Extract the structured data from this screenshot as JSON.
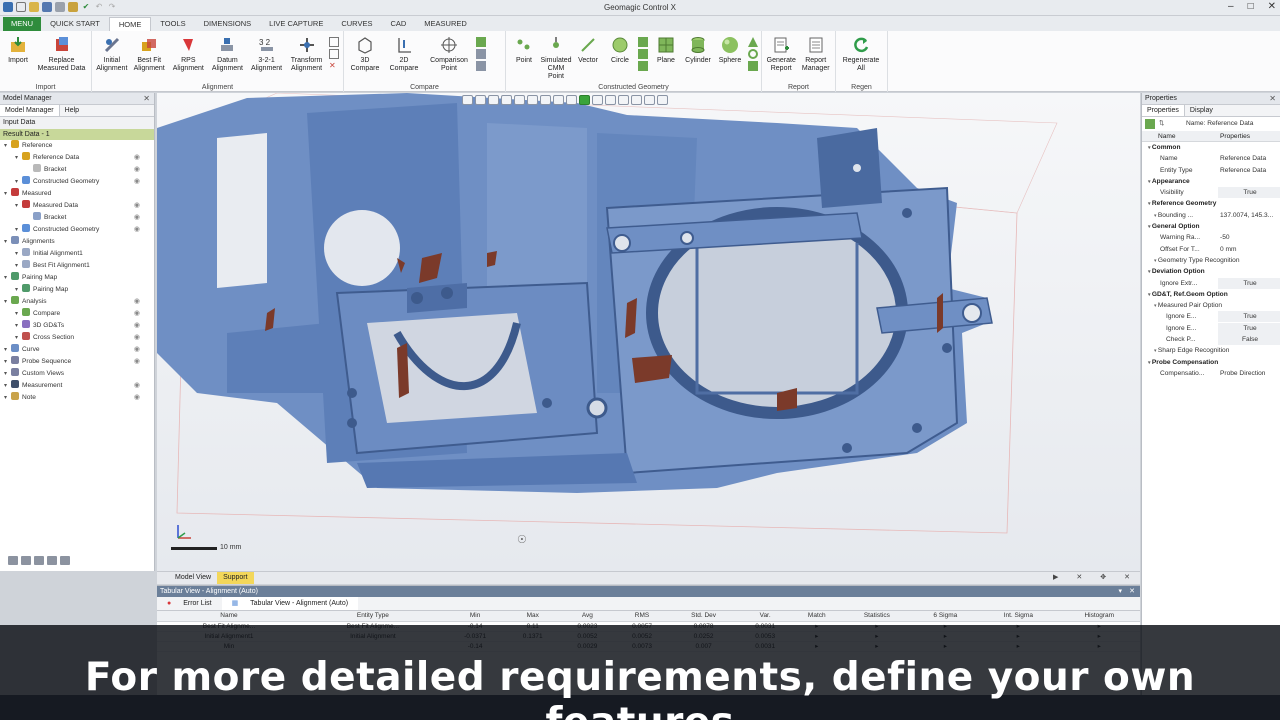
{
  "app": {
    "title": "Geomagic Control X"
  },
  "tabs": [
    "MENU",
    "QUICK START",
    "HOME",
    "TOOLS",
    "DIMENSIONS",
    "LIVE CAPTURE",
    "CURVES",
    "CAD",
    "MEASURED"
  ],
  "ribbon": {
    "groups": [
      {
        "label": "Import",
        "buttons": [
          "Import",
          "Replace Measured Data"
        ]
      },
      {
        "label": "Alignment",
        "buttons": [
          "Initial Alignment",
          "Best Fit Alignment",
          "RPS Alignment",
          "Datum Alignment",
          "3-2-1 Alignment",
          "Transform Alignment"
        ]
      },
      {
        "label": "Compare",
        "buttons": [
          "3D Compare",
          "2D Compare",
          "Comparison Point"
        ]
      },
      {
        "label": "Constructed Geometry",
        "buttons": [
          "Point",
          "Simulated CMM Point",
          "Vector",
          "Circle",
          "Plane",
          "Cylinder",
          "Sphere"
        ]
      },
      {
        "label": "Report",
        "buttons": [
          "Generate Report",
          "Report Manager"
        ]
      },
      {
        "label": "Regen",
        "buttons": [
          "Regenerate All"
        ]
      }
    ]
  },
  "left_panel": {
    "title": "Model Manager",
    "tabs": [
      "Model Manager",
      "Help"
    ],
    "section": "Input Data",
    "result": "Result Data - 1",
    "tree": [
      {
        "label": "Reference",
        "indent": 0,
        "color": "#d7a21e",
        "eye": false
      },
      {
        "label": "Reference Data",
        "indent": 1,
        "color": "#d7a21e",
        "eye": true
      },
      {
        "label": "Bracket",
        "indent": 2,
        "color": "#b9b9b9",
        "eye": true
      },
      {
        "label": "Constructed Geometry",
        "indent": 1,
        "color": "#5b8fd8",
        "eye": true
      },
      {
        "label": "Measured",
        "indent": 0,
        "color": "#c43b3b",
        "eye": false
      },
      {
        "label": "Measured Data",
        "indent": 1,
        "color": "#c43b3b",
        "eye": true
      },
      {
        "label": "Bracket",
        "indent": 2,
        "color": "#8aa0c8",
        "eye": true
      },
      {
        "label": "Constructed Geometry",
        "indent": 1,
        "color": "#5b8fd8",
        "eye": true
      },
      {
        "label": "Alignments",
        "indent": 0,
        "color": "#7b8fb8",
        "eye": false
      },
      {
        "label": "Initial Alignment1",
        "indent": 1,
        "color": "#9aa8c4",
        "eye": false
      },
      {
        "label": "Best Fit Alignment1",
        "indent": 1,
        "color": "#9aa8c4",
        "eye": false
      },
      {
        "label": "Pairing Map",
        "indent": 0,
        "color": "#4f9a6a",
        "eye": false
      },
      {
        "label": "Pairing Map",
        "indent": 1,
        "color": "#4f9a6a",
        "eye": false
      },
      {
        "label": "Analysis",
        "indent": 0,
        "color": "#6aa84f",
        "eye": true
      },
      {
        "label": "Compare",
        "indent": 1,
        "color": "#6aa84f",
        "eye": true
      },
      {
        "label": "3D GD&Ts",
        "indent": 1,
        "color": "#8a6fc0",
        "eye": true
      },
      {
        "label": "Cross Section",
        "indent": 1,
        "color": "#c0504d",
        "eye": true
      },
      {
        "label": "Curve",
        "indent": 0,
        "color": "#6b8ec6",
        "eye": true
      },
      {
        "label": "Probe Sequence",
        "indent": 0,
        "color": "#7a7fa0",
        "eye": true
      },
      {
        "label": "Custom Views",
        "indent": 0,
        "color": "#7a7fa0",
        "eye": false
      },
      {
        "label": "Measurement",
        "indent": 0,
        "color": "#3f4f6a",
        "eye": true
      },
      {
        "label": "Note",
        "indent": 0,
        "color": "#c9a34a",
        "eye": true
      }
    ]
  },
  "viewport": {
    "scale_label": "10 mm",
    "tabs": [
      "Model View",
      "Support"
    ]
  },
  "tabular": {
    "title": "Tabular View - Alignment (Auto)",
    "tabs": [
      "Error List",
      "Tabular View - Alignment (Auto)"
    ],
    "columns": [
      "Name",
      "Entity Type",
      "Min",
      "Max",
      "Avg",
      "RMS",
      "Std. Dev",
      "Var.",
      "Match",
      "Statistics",
      "6 Sigma",
      "Int. Sigma",
      "Histogram"
    ],
    "rows": [
      [
        "Best Fit Alignme...",
        "Best Fit Alignme...",
        "-0.14",
        "0.11",
        "0.0023",
        "0.0057",
        "0.0078",
        "0.0031",
        "▸",
        "▸",
        "▸",
        "▸",
        "▸"
      ],
      [
        "Initial Alignment1",
        "Initial Alignment",
        "-0.0371",
        "0.1371",
        "0.0052",
        "0.0052",
        "0.0252",
        "0.0053",
        "▸",
        "▸",
        "▸",
        "▸",
        "▸"
      ],
      [
        "Min",
        "",
        "-0.14",
        "",
        "0.0029",
        "0.0073",
        "0.007",
        "0.0031",
        "▸",
        "▸",
        "▸",
        "▸",
        "▸"
      ]
    ]
  },
  "properties": {
    "title": "Properties",
    "tabs": [
      "Properties",
      "Display"
    ],
    "name_label": "Name: Reference Data",
    "col_name": "Name",
    "col_props": "Properties",
    "rows": [
      {
        "k": "Common",
        "v": "",
        "cat": true
      },
      {
        "k": "Name",
        "v": "Reference Data",
        "indent": 2
      },
      {
        "k": "Entity Type",
        "v": "Reference Data",
        "indent": 2
      },
      {
        "k": "Appearance",
        "v": "",
        "cat": true
      },
      {
        "k": "Visibility",
        "v": "True",
        "indent": 2,
        "box": true
      },
      {
        "k": "Reference Geometry",
        "v": "",
        "cat": true
      },
      {
        "k": "Bounding ...",
        "v": "137.0074, 145.3...",
        "indent": 1
      },
      {
        "k": "General Option",
        "v": "",
        "cat": true
      },
      {
        "k": "Warning Ra...",
        "v": "-50",
        "indent": 2
      },
      {
        "k": "Offset For T...",
        "v": "0 mm",
        "indent": 2
      },
      {
        "k": "Geometry Type Recognition",
        "v": "",
        "indent": 1
      },
      {
        "k": "Deviation Option",
        "v": "",
        "cat": true
      },
      {
        "k": "Ignore Extr...",
        "v": "True",
        "indent": 2,
        "box": true
      },
      {
        "k": "GD&T, Ref.Geom Option",
        "v": "",
        "cat": true
      },
      {
        "k": "Measured Pair Option",
        "v": "",
        "indent": 1
      },
      {
        "k": "Ignore E...",
        "v": "True",
        "indent": 3,
        "box": true
      },
      {
        "k": "Ignore E...",
        "v": "True",
        "indent": 3,
        "box": true
      },
      {
        "k": "Check P...",
        "v": "False",
        "indent": 3,
        "box": true
      },
      {
        "k": "Sharp Edge Recognition",
        "v": "",
        "indent": 1
      },
      {
        "k": "Probe Compensation",
        "v": "",
        "cat": true
      },
      {
        "k": "Compensatio...",
        "v": "Probe Direction",
        "indent": 2
      }
    ]
  },
  "caption": "For more detailed requirements, define your own features"
}
